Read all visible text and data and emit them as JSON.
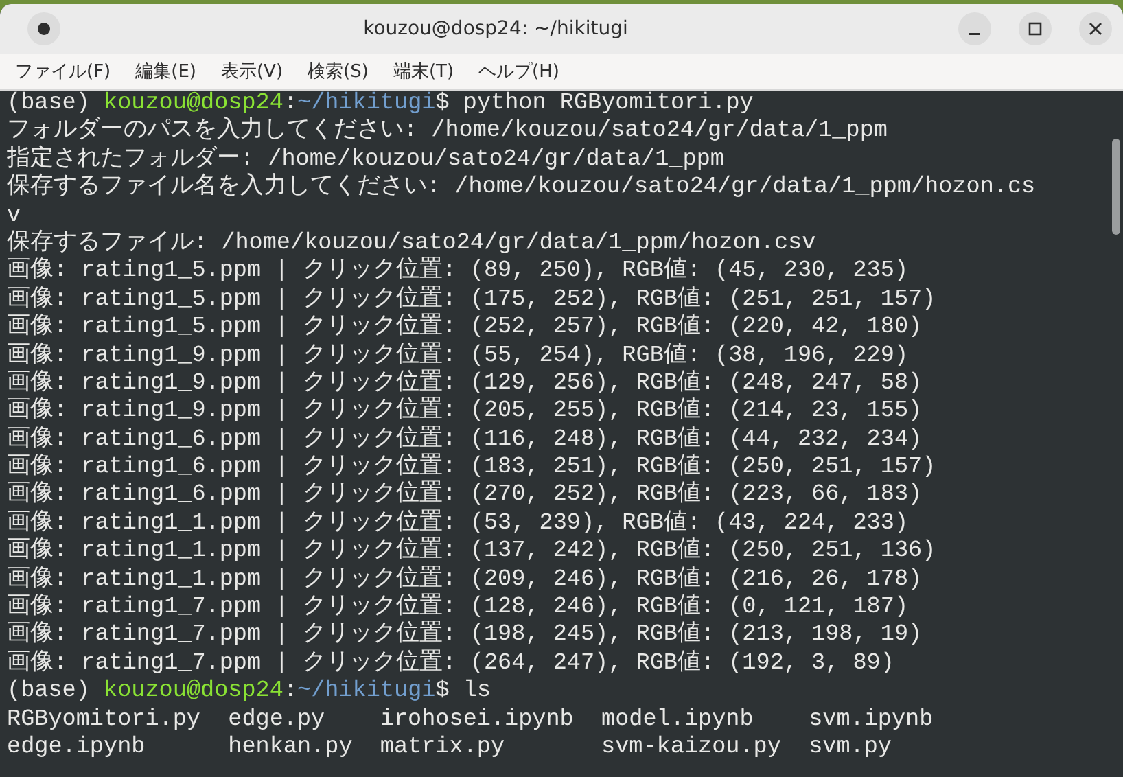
{
  "window": {
    "title": "kouzou@dosp24: ~/hikitugi"
  },
  "menu": [
    "ファイル(F)",
    "編集(E)",
    "表示(V)",
    "検索(S)",
    "端末(T)",
    "ヘルプ(H)"
  ],
  "terminal": {
    "lines": [
      {
        "kind": "prompt",
        "env": "(base)",
        "user_host": "kouzou@dosp24",
        "separator": ":",
        "path": "~/hikitugi",
        "symbol": "$",
        "command": "python RGByomitori.py"
      },
      {
        "kind": "output",
        "text": "フォルダーのパスを入力してください: /home/kouzou/sato24/gr/data/1_ppm"
      },
      {
        "kind": "output",
        "text": "指定されたフォルダー: /home/kouzou/sato24/gr/data/1_ppm"
      },
      {
        "kind": "output",
        "text": "保存するファイル名を入力してください: /home/kouzou/sato24/gr/data/1_ppm/hozon.cs"
      },
      {
        "kind": "output",
        "text": "v"
      },
      {
        "kind": "output",
        "text": "保存するファイル: /home/kouzou/sato24/gr/data/1_ppm/hozon.csv"
      },
      {
        "kind": "output",
        "text": "画像: rating1_5.ppm | クリック位置: (89, 250), RGB値: (45, 230, 235)"
      },
      {
        "kind": "output",
        "text": "画像: rating1_5.ppm | クリック位置: (175, 252), RGB値: (251, 251, 157)"
      },
      {
        "kind": "output",
        "text": "画像: rating1_5.ppm | クリック位置: (252, 257), RGB値: (220, 42, 180)"
      },
      {
        "kind": "output",
        "text": "画像: rating1_9.ppm | クリック位置: (55, 254), RGB値: (38, 196, 229)"
      },
      {
        "kind": "output",
        "text": "画像: rating1_9.ppm | クリック位置: (129, 256), RGB値: (248, 247, 58)"
      },
      {
        "kind": "output",
        "text": "画像: rating1_9.ppm | クリック位置: (205, 255), RGB値: (214, 23, 155)"
      },
      {
        "kind": "output",
        "text": "画像: rating1_6.ppm | クリック位置: (116, 248), RGB値: (44, 232, 234)"
      },
      {
        "kind": "output",
        "text": "画像: rating1_6.ppm | クリック位置: (183, 251), RGB値: (250, 251, 157)"
      },
      {
        "kind": "output",
        "text": "画像: rating1_6.ppm | クリック位置: (270, 252), RGB値: (223, 66, 183)"
      },
      {
        "kind": "output",
        "text": "画像: rating1_1.ppm | クリック位置: (53, 239), RGB値: (43, 224, 233)"
      },
      {
        "kind": "output",
        "text": "画像: rating1_1.ppm | クリック位置: (137, 242), RGB値: (250, 251, 136)"
      },
      {
        "kind": "output",
        "text": "画像: rating1_1.ppm | クリック位置: (209, 246), RGB値: (216, 26, 178)"
      },
      {
        "kind": "output",
        "text": "画像: rating1_7.ppm | クリック位置: (128, 246), RGB値: (0, 121, 187)"
      },
      {
        "kind": "output",
        "text": "画像: rating1_7.ppm | クリック位置: (198, 245), RGB値: (213, 198, 19)"
      },
      {
        "kind": "output",
        "text": "画像: rating1_7.ppm | クリック位置: (264, 247), RGB値: (192, 3, 89)"
      },
      {
        "kind": "prompt",
        "env": "(base)",
        "user_host": "kouzou@dosp24",
        "separator": ":",
        "path": "~/hikitugi",
        "symbol": "$",
        "command": "ls"
      },
      {
        "kind": "columns",
        "cells": [
          "RGByomitori.py",
          "edge.py",
          "irohosei.ipynb",
          "model.ipynb",
          "svm.ipynb"
        ]
      },
      {
        "kind": "columns",
        "cells": [
          "edge.ipynb",
          "henkan.py",
          "matrix.py",
          "svm-kaizou.py",
          "svm.py"
        ]
      }
    ]
  }
}
